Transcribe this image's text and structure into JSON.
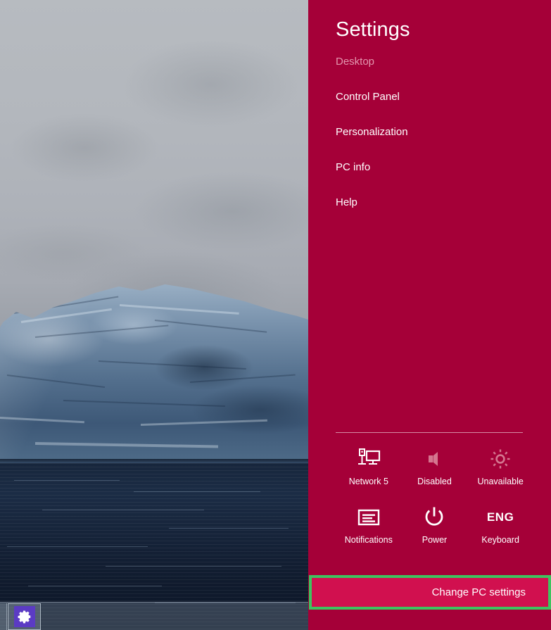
{
  "panel": {
    "title": "Settings",
    "accent_color": "#a50038",
    "highlight_border_color": "#3ec45f",
    "button_color": "#d1104f",
    "links": [
      {
        "label": "Desktop",
        "state": "dimmed"
      },
      {
        "label": "Control Panel",
        "state": "normal"
      },
      {
        "label": "Personalization",
        "state": "normal"
      },
      {
        "label": "PC info",
        "state": "normal"
      },
      {
        "label": "Help",
        "state": "normal"
      }
    ],
    "quick_settings": [
      {
        "icon": "network-monitor-icon",
        "label": "Network  5",
        "state": "enabled"
      },
      {
        "icon": "volume-mute-icon",
        "label": "Disabled",
        "state": "disabled"
      },
      {
        "icon": "brightness-sun-icon",
        "label": "Unavailable",
        "state": "disabled"
      },
      {
        "icon": "notifications-icon",
        "label": "Notifications",
        "state": "enabled"
      },
      {
        "icon": "power-icon",
        "label": "Power",
        "state": "enabled"
      },
      {
        "icon": "keyboard-lang-icon",
        "label": "Keyboard",
        "state": "enabled",
        "glyph_text": "ENG"
      }
    ],
    "change_pc_settings": "Change PC settings"
  },
  "taskbar": {
    "buttons": [
      {
        "icon": "gear-icon",
        "label": "",
        "color": "#5b3bc4"
      }
    ]
  },
  "desktop": {
    "wallpaper_description": "Iceberg over dark water under overcast sky"
  }
}
